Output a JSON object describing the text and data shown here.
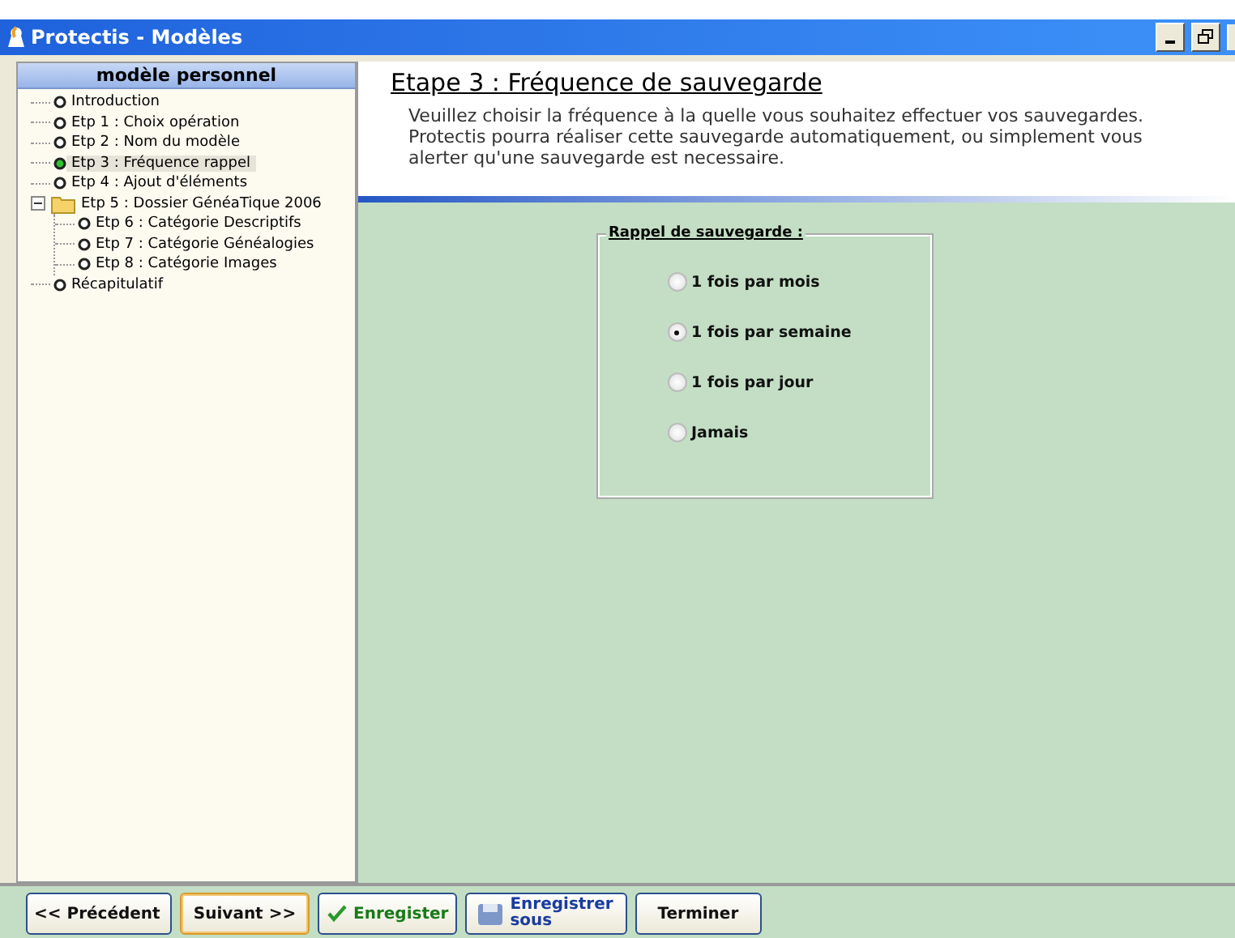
{
  "window": {
    "title": "Protectis - Modèles"
  },
  "sidebar": {
    "title": "modèle personnel",
    "items": [
      {
        "label": "Introduction",
        "kind": "step",
        "selected": false
      },
      {
        "label": "Etp 1 : Choix opération",
        "kind": "step",
        "selected": false
      },
      {
        "label": "Etp 2 : Nom du modèle",
        "kind": "step",
        "selected": false
      },
      {
        "label": "Etp 3 : Fréquence rappel",
        "kind": "step",
        "selected": true
      },
      {
        "label": "Etp 4 : Ajout d'éléments",
        "kind": "step",
        "selected": false
      },
      {
        "label": "Etp 5 : Dossier GénéaTique 2006",
        "kind": "folder",
        "selected": false,
        "expanded": true,
        "children": [
          {
            "label": "Etp 6 : Catégorie Descriptifs",
            "kind": "step",
            "selected": false
          },
          {
            "label": "Etp 7 : Catégorie Généalogies",
            "kind": "step",
            "selected": false
          },
          {
            "label": "Etp 8 : Catégorie Images",
            "kind": "step",
            "selected": false
          }
        ]
      },
      {
        "label": "Récapitulatif",
        "kind": "step",
        "selected": false
      }
    ]
  },
  "header": {
    "title": "Etape 3 : Fréquence de sauvegarde",
    "description": "Veuillez choisir la fréquence à la quelle vous souhaitez effectuer vos sauvegardes. Protectis pourra réaliser cette sauvegarde automatiquement, ou simplement vous alerter qu'une sauvegarde est necessaire."
  },
  "group": {
    "title": "Rappel de sauvegarde :",
    "options": [
      {
        "label": "1 fois par mois",
        "selected": false
      },
      {
        "label": "1 fois par semaine",
        "selected": true
      },
      {
        "label": "1 fois par jour",
        "selected": false
      },
      {
        "label": "Jamais",
        "selected": false
      }
    ]
  },
  "buttons": [
    {
      "label": "<< Précédent",
      "kind": "plain",
      "focused": false
    },
    {
      "label": "Suivant >>",
      "kind": "plain",
      "focused": true
    },
    {
      "label": "Enregister",
      "kind": "check",
      "focused": false
    },
    {
      "label": "Enregistrer sous",
      "kind": "disk",
      "focused": false
    },
    {
      "label": "Terminer",
      "kind": "plain",
      "focused": false
    }
  ]
}
